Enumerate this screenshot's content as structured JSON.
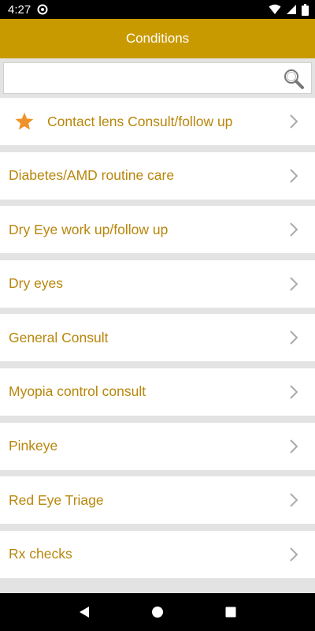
{
  "status_bar": {
    "time": "4:27",
    "icons": [
      "sync-icon",
      "wifi-icon",
      "signal-icon",
      "battery-icon"
    ]
  },
  "header": {
    "title": "Conditions",
    "background_color": "#c99a00"
  },
  "search": {
    "value": "",
    "placeholder": ""
  },
  "conditions": {
    "items": [
      {
        "label": "Contact lens Consult/follow up",
        "starred": true
      },
      {
        "label": "Diabetes/AMD routine care",
        "starred": false
      },
      {
        "label": "Dry Eye work up/follow up",
        "starred": false
      },
      {
        "label": "Dry eyes",
        "starred": false
      },
      {
        "label": "General Consult",
        "starred": false
      },
      {
        "label": "Myopia control consult",
        "starred": false
      },
      {
        "label": "Pinkeye",
        "starred": false
      },
      {
        "label": "Red Eye Triage",
        "starred": false
      },
      {
        "label": "Rx checks",
        "starred": false
      }
    ],
    "label_color": "#b8860b",
    "star_color": "#f0922a"
  },
  "nav_bar": {
    "buttons": [
      "back-icon",
      "home-icon",
      "recents-icon"
    ]
  }
}
